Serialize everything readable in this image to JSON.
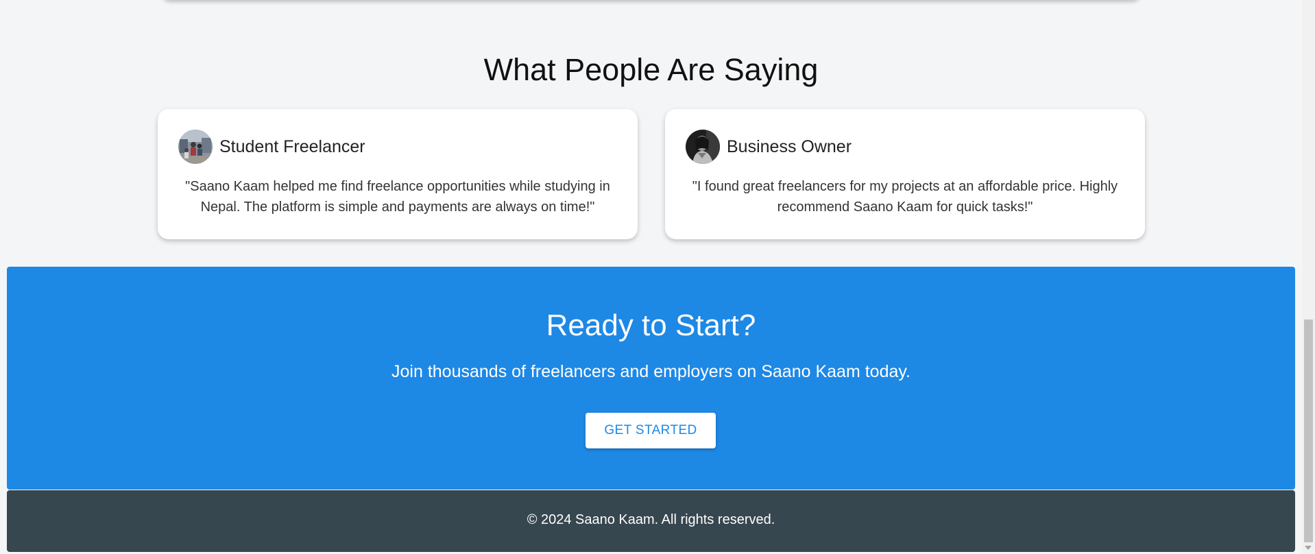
{
  "testimonials_section": {
    "title": "What People Are Saying",
    "items": [
      {
        "role": "Student Freelancer",
        "avatar_icon": "student-avatar-photo",
        "quote": "\"Saano Kaam helped me find freelance opportunities while studying in Nepal. The platform is simple and payments are always on time!\""
      },
      {
        "role": "Business Owner",
        "avatar_icon": "business-owner-avatar-photo",
        "quote": "\"I found great freelancers for my projects at an affordable price. Highly recommend Saano Kaam for quick tasks!\""
      }
    ]
  },
  "cta": {
    "title": "Ready to Start?",
    "subtitle": "Join thousands of freelancers and employers on Saano Kaam today.",
    "button_label": "GET STARTED",
    "background_color": "#1e88e5"
  },
  "footer": {
    "text": "© 2024 Saano Kaam. All rights reserved.",
    "background_color": "#37474f"
  }
}
